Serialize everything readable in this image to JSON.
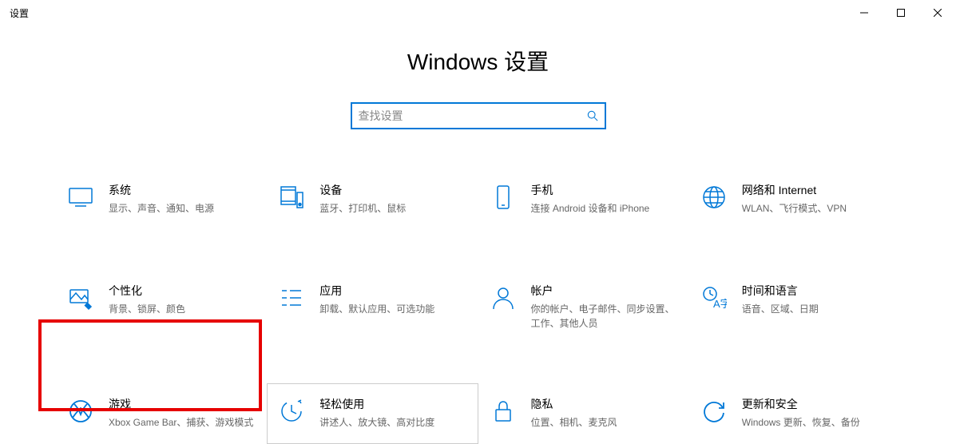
{
  "window": {
    "title": "设置"
  },
  "header": {
    "page_title": "Windows 设置"
  },
  "search": {
    "placeholder": "查找设置"
  },
  "categories": [
    {
      "id": "system",
      "title": "系统",
      "desc": "显示、声音、通知、电源"
    },
    {
      "id": "devices",
      "title": "设备",
      "desc": "蓝牙、打印机、鼠标"
    },
    {
      "id": "phone",
      "title": "手机",
      "desc": "连接 Android 设备和 iPhone"
    },
    {
      "id": "network",
      "title": "网络和 Internet",
      "desc": "WLAN、飞行模式、VPN"
    },
    {
      "id": "personalization",
      "title": "个性化",
      "desc": "背景、锁屏、颜色"
    },
    {
      "id": "apps",
      "title": "应用",
      "desc": "卸载、默认应用、可选功能"
    },
    {
      "id": "accounts",
      "title": "帐户",
      "desc": "你的帐户、电子邮件、同步设置、工作、其他人员"
    },
    {
      "id": "time",
      "title": "时间和语言",
      "desc": "语音、区域、日期"
    },
    {
      "id": "gaming",
      "title": "游戏",
      "desc": "Xbox Game Bar、捕获、游戏模式"
    },
    {
      "id": "ease",
      "title": "轻松使用",
      "desc": "讲述人、放大镜、高对比度"
    },
    {
      "id": "privacy",
      "title": "隐私",
      "desc": "位置、相机、麦克风"
    },
    {
      "id": "update",
      "title": "更新和安全",
      "desc": "Windows 更新、恢复、备份"
    }
  ]
}
